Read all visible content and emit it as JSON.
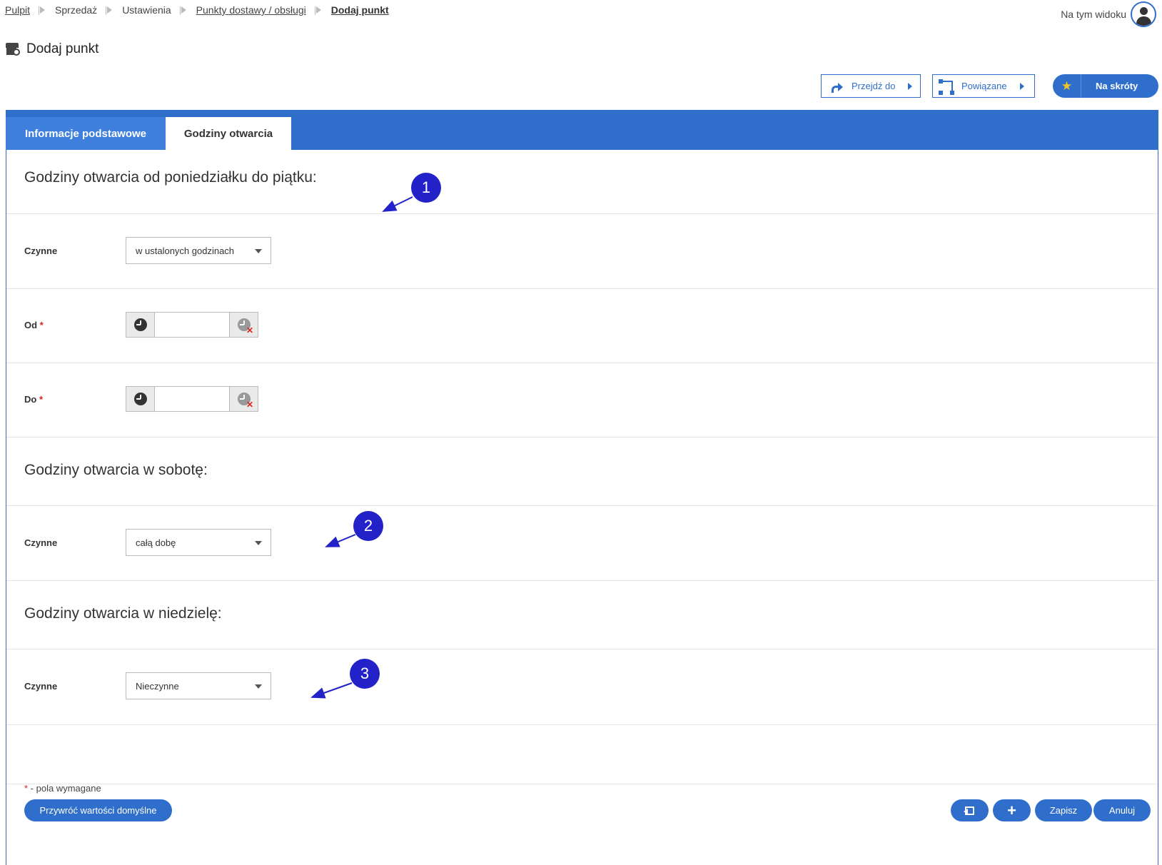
{
  "breadcrumb": [
    "Pulpit",
    "Sprzedaż",
    "Ustawienia",
    "Punkty dostawy / obsługi",
    "Dodaj punkt"
  ],
  "header": {
    "view_label": "Na tym widoku"
  },
  "page": {
    "title": "Dodaj punkt"
  },
  "toolbar": {
    "goto_label": "Przejdź do",
    "related_label": "Powiązane",
    "shortcuts_label": "Na skróty"
  },
  "tabs": [
    {
      "label": "Informacje podstawowe",
      "active": false
    },
    {
      "label": "Godziny otwarcia",
      "active": true
    }
  ],
  "weekday": {
    "title": "Godziny otwarcia od poniedziałku do piątku:",
    "open_label": "Czynne",
    "open_value": "w ustalonych godzinach",
    "from_label": "Od",
    "to_label": "Do",
    "from_value": "",
    "to_value": ""
  },
  "saturday": {
    "title": "Godziny otwarcia w sobotę:",
    "open_label": "Czynne",
    "open_value": "całą dobę"
  },
  "sunday": {
    "title": "Godziny otwarcia w niedzielę:",
    "open_label": "Czynne",
    "open_value": "Nieczynne"
  },
  "required_marker": "*",
  "required_note": " - pola wymagane",
  "footer": {
    "reset_label": "Przywróć wartości domyślne",
    "add_label": "+",
    "save_label": "Zapisz",
    "cancel_label": "Anuluj"
  },
  "annotations": [
    "1",
    "2",
    "3"
  ],
  "colors": {
    "primary": "#2f6fcb",
    "tab_inactive": "#3f80dd",
    "annotation": "#2222c8",
    "required": "#d9261c"
  },
  "icons": [
    "store-icon",
    "user-icon",
    "share-arrow-icon",
    "related-nodes-icon",
    "star-icon",
    "clock-icon",
    "clock-clear-icon",
    "dropdown-caret-icon",
    "back-icon"
  ]
}
